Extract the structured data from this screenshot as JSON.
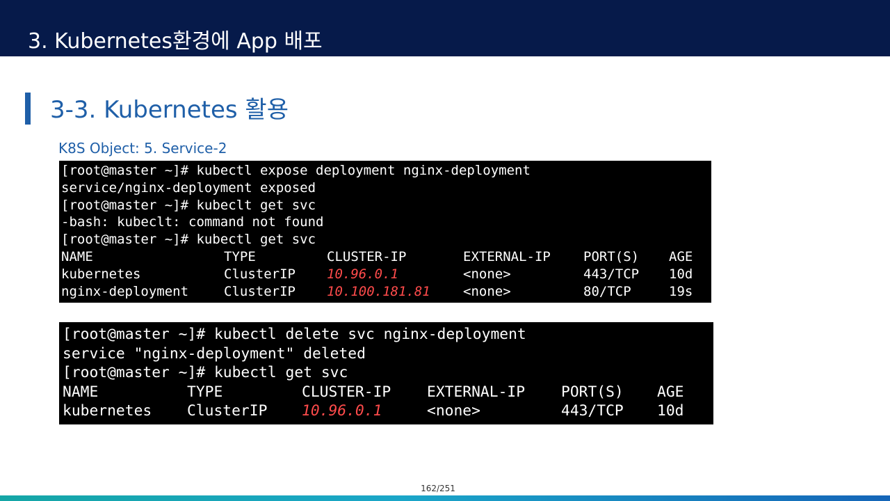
{
  "header": {
    "title": "3.  Kubernetes환경에 App 배포"
  },
  "section": {
    "title": "3-3. Kubernetes 활용",
    "caption": "K8S Object: 5. Service-2"
  },
  "terminal_1": {
    "lines": [
      "[root@master ~]# kubectl expose deployment nginx-deployment",
      "service/nginx-deployment exposed",
      "[root@master ~]# kubeclt get svc",
      "-bash: kubeclt: command not found",
      "[root@master ~]# kubectl get svc"
    ],
    "table": {
      "headers": [
        "NAME",
        "TYPE",
        "CLUSTER-IP",
        "EXTERNAL-IP",
        "PORT(S)",
        "AGE"
      ],
      "rows": [
        [
          "kubernetes",
          "ClusterIP",
          "10.96.0.1",
          "<none>",
          "443/TCP",
          "10d"
        ],
        [
          "nginx-deployment",
          "ClusterIP",
          "10.100.181.81",
          "<none>",
          "80/TCP",
          "19s"
        ]
      ]
    }
  },
  "terminal_2": {
    "lines": [
      "[root@master ~]# kubectl delete svc nginx-deployment",
      "service \"nginx-deployment\" deleted",
      "[root@master ~]# kubectl get svc"
    ],
    "table": {
      "headers": [
        "NAME",
        "TYPE",
        "CLUSTER-IP",
        "EXTERNAL-IP",
        "PORT(S)",
        "AGE"
      ],
      "rows": [
        [
          "kubernetes",
          "ClusterIP",
          "10.96.0.1",
          "<none>",
          "443/TCP",
          "10d"
        ]
      ]
    }
  },
  "footer": {
    "page": "162/251"
  },
  "colors": {
    "header_bg": "#061a4a",
    "accent_blue": "#1f5fa8",
    "terminal_bg": "#000000",
    "ip_red": "#ff4b4b"
  }
}
